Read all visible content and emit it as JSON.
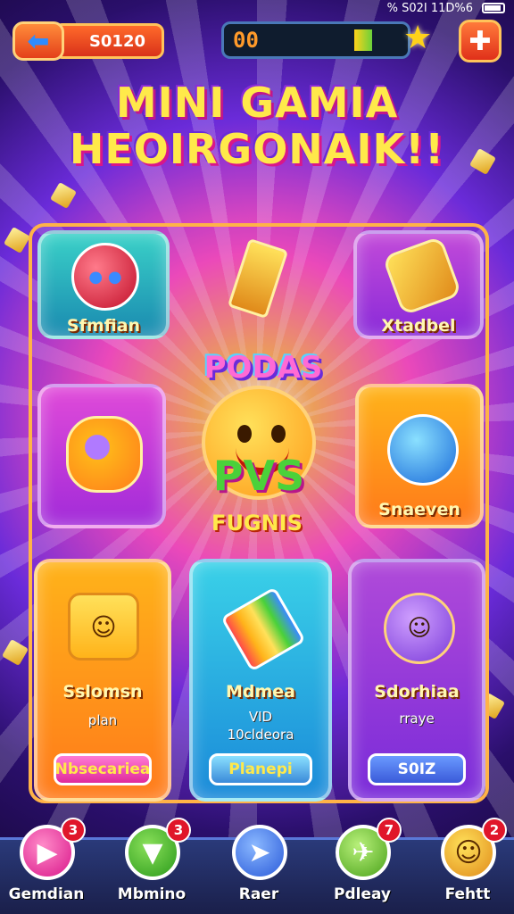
{
  "status_bar": {
    "text": "%  S02I  11D%6"
  },
  "top_bar": {
    "coins": "S0120",
    "progress_value": "00"
  },
  "title": {
    "line1": "MINI GAMIA",
    "line2": "HEOIRGONAIK!!"
  },
  "cards": {
    "top_left": {
      "label": "Sfmfian"
    },
    "top_right": {
      "label": "Xtadbel"
    },
    "mid_left": {
      "label": ""
    },
    "mid_right": {
      "label": "Snaeven"
    },
    "bottom_left": {
      "label": "Sslomsn",
      "sub": "plan",
      "button": "Nbsecariea"
    },
    "bottom_center": {
      "label": "Mdmea",
      "sub1": "VID",
      "sub2": "10cldeora",
      "button": "Planepi"
    },
    "bottom_right": {
      "label": "Sdorhiaa",
      "sub": "rraye",
      "button": "S0IZ"
    }
  },
  "feature": {
    "title": "PODAS",
    "word": "PVS",
    "subtitle": "FUGNIS"
  },
  "nav": [
    {
      "label": "Gemdian",
      "badge": "3",
      "icon": "play-icon"
    },
    {
      "label": "Mbmino",
      "badge": "3",
      "icon": "slice-icon"
    },
    {
      "label": "Raer",
      "badge": "",
      "icon": "arrow-icon"
    },
    {
      "label": "Pdleay",
      "badge": "7",
      "icon": "rocket-icon"
    },
    {
      "label": "Fehtt",
      "badge": "2",
      "icon": "cookie-icon"
    }
  ]
}
